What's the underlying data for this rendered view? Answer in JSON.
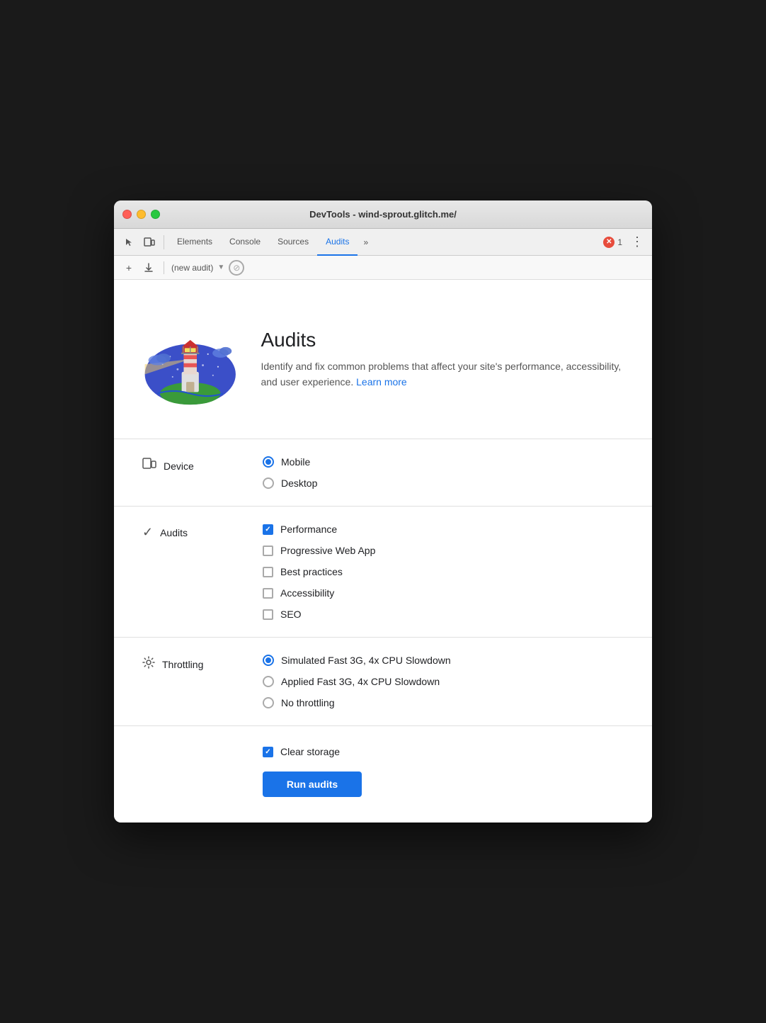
{
  "window": {
    "title": "DevTools - wind-sprout.glitch.me/"
  },
  "tabs": {
    "items": [
      {
        "label": "Elements",
        "active": false
      },
      {
        "label": "Console",
        "active": false
      },
      {
        "label": "Sources",
        "active": false
      },
      {
        "label": "Audits",
        "active": true
      }
    ],
    "more_label": "»",
    "error_count": "1"
  },
  "toolbar2": {
    "new_label": "+",
    "download_label": "↓",
    "audit_name": "(new audit)",
    "caret": "▼"
  },
  "hero": {
    "title": "Audits",
    "description": "Identify and fix common problems that affect your site's performance, accessibility, and user experience.",
    "learn_more": "Learn more"
  },
  "device": {
    "label": "Device",
    "options": [
      {
        "label": "Mobile",
        "checked": true
      },
      {
        "label": "Desktop",
        "checked": false
      }
    ]
  },
  "audits": {
    "label": "Audits",
    "options": [
      {
        "label": "Performance",
        "checked": true
      },
      {
        "label": "Progressive Web App",
        "checked": false
      },
      {
        "label": "Best practices",
        "checked": false
      },
      {
        "label": "Accessibility",
        "checked": false
      },
      {
        "label": "SEO",
        "checked": false
      }
    ]
  },
  "throttling": {
    "label": "Throttling",
    "options": [
      {
        "label": "Simulated Fast 3G, 4x CPU Slowdown",
        "checked": true
      },
      {
        "label": "Applied Fast 3G, 4x CPU Slowdown",
        "checked": false
      },
      {
        "label": "No throttling",
        "checked": false
      }
    ]
  },
  "clear_storage": {
    "label": "Clear storage",
    "checked": true
  },
  "run_button": {
    "label": "Run audits"
  }
}
